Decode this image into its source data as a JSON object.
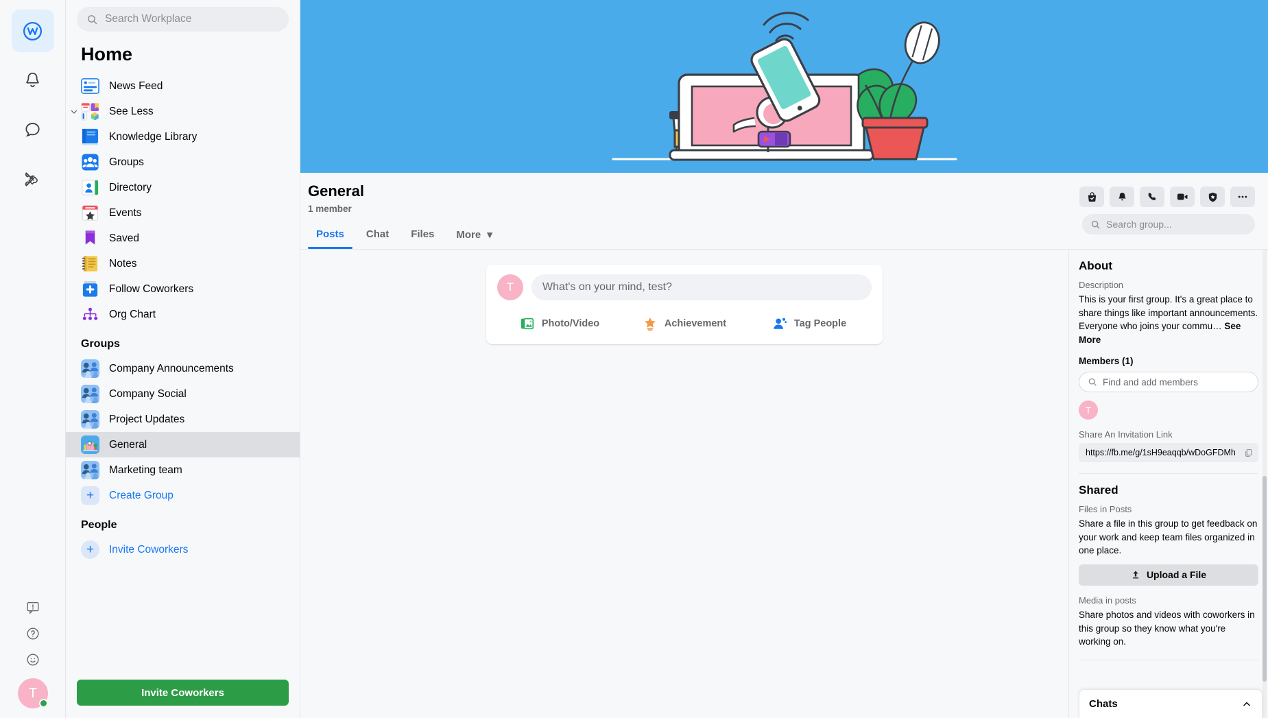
{
  "rail": {
    "items": [
      {
        "name": "workplace-home",
        "icon": "workplace-logo-icon",
        "active": true
      },
      {
        "name": "notifications",
        "icon": "bell-icon",
        "active": false
      },
      {
        "name": "chat",
        "icon": "chat-bubble-icon",
        "active": false
      },
      {
        "name": "tools",
        "icon": "tools-icon",
        "active": false
      }
    ],
    "bottom": [
      {
        "name": "feedback",
        "icon": "feedback-icon"
      },
      {
        "name": "help",
        "icon": "help-icon"
      },
      {
        "name": "emoji",
        "icon": "smiley-icon"
      }
    ],
    "avatar_letter": "T"
  },
  "search": {
    "placeholder": "Search Workplace"
  },
  "sidebar": {
    "title": "Home",
    "nav": [
      {
        "label": "News Feed",
        "icon": "news-feed-icon"
      },
      {
        "label": "See Less",
        "icon": "see-less-icon",
        "chevron": true
      },
      {
        "label": "Knowledge Library",
        "icon": "knowledge-library-icon"
      },
      {
        "label": "Groups",
        "icon": "groups-icon"
      },
      {
        "label": "Directory",
        "icon": "directory-icon"
      },
      {
        "label": "Events",
        "icon": "events-icon"
      },
      {
        "label": "Saved",
        "icon": "saved-icon"
      },
      {
        "label": "Notes",
        "icon": "notes-icon"
      },
      {
        "label": "Follow Coworkers",
        "icon": "follow-coworkers-icon"
      },
      {
        "label": "Org Chart",
        "icon": "org-chart-icon"
      }
    ],
    "groups_heading": "Groups",
    "groups": [
      {
        "label": "Company Announcements",
        "selected": false
      },
      {
        "label": "Company Social",
        "selected": false
      },
      {
        "label": "Project Updates",
        "selected": false
      },
      {
        "label": "General",
        "selected": true
      },
      {
        "label": "Marketing team",
        "selected": false
      }
    ],
    "create_group": "Create Group",
    "people_heading": "People",
    "invite_coworkers_link": "Invite Coworkers",
    "invite_coworkers_button": "Invite Coworkers"
  },
  "group": {
    "name": "General",
    "members_text": "1 member",
    "tabs": [
      {
        "label": "Posts",
        "active": true
      },
      {
        "label": "Chat",
        "active": false
      },
      {
        "label": "Files",
        "active": false
      },
      {
        "label": "More",
        "active": false,
        "caret": true
      }
    ],
    "actions": [
      {
        "name": "join-group-button",
        "icon": "bag-check-icon"
      },
      {
        "name": "notifications-button",
        "icon": "bell-icon"
      },
      {
        "name": "audio-call-button",
        "icon": "phone-icon"
      },
      {
        "name": "video-call-button",
        "icon": "video-camera-icon"
      },
      {
        "name": "privacy-button",
        "icon": "shield-star-icon"
      },
      {
        "name": "more-options-button",
        "icon": "ellipsis-icon"
      }
    ],
    "search_placeholder": "Search group..."
  },
  "composer": {
    "avatar_letter": "T",
    "placeholder": "What's on your mind, test?",
    "actions": [
      {
        "label": "Photo/Video",
        "icon": "photo-video-icon"
      },
      {
        "label": "Achievement",
        "icon": "achievement-icon"
      },
      {
        "label": "Tag People",
        "icon": "tag-people-icon"
      }
    ]
  },
  "about": {
    "heading": "About",
    "description_label": "Description",
    "description": "This is your first group. It's a great place to share things like important announcements. Everyone who joins your commu…",
    "see_more": "See More",
    "members_label": "Members (1)",
    "find_members_placeholder": "Find and add members",
    "member_avatar_letter": "T",
    "invitation_label": "Share An Invitation Link",
    "invitation_link": "https://fb.me/g/1sH9eaqqb/wDoGFDMh"
  },
  "shared": {
    "heading": "Shared",
    "files_label": "Files in Posts",
    "files_text": "Share a file in this group to get feedback on your work and keep team files organized in one place.",
    "upload_label": "Upload a File",
    "media_label": "Media in posts",
    "media_text": "Share photos and videos with coworkers in this group so they know what you're working on."
  },
  "chats": {
    "label": "Chats"
  },
  "colors": {
    "cover_blue": "#4aabeb",
    "accent_blue": "#1877f2",
    "invite_green": "#2d9c47",
    "avatar_pink": "#f9b3c6",
    "selected_gray": "#dcdee1",
    "panel_bg": "#f7f8fa"
  }
}
